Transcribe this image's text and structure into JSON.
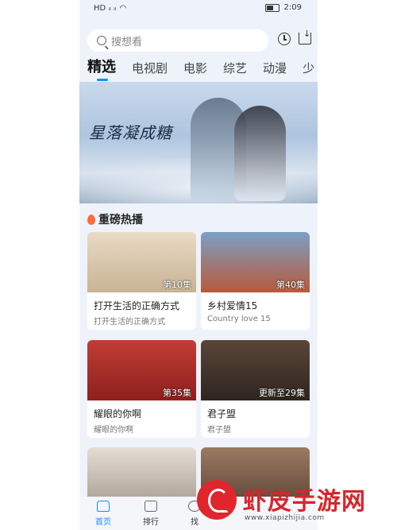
{
  "status_bar": {
    "time": "2:09",
    "signal": "HD ᵢₗ ᵢₗ"
  },
  "search": {
    "placeholder": "搜想看"
  },
  "tabs": [
    "精选",
    "电视剧",
    "电影",
    "综艺",
    "动漫",
    "少"
  ],
  "banner": {
    "title": "星落凝成糖"
  },
  "section": {
    "title": "重磅热播"
  },
  "cards": [
    {
      "title": "打开生活的正确方式",
      "subtitle": "打开生活的正确方式",
      "badge": "第10集",
      "thumb_color": "#d9c6ad"
    },
    {
      "title": "乡村爱情15",
      "subtitle": "Country love 15",
      "badge": "第40集",
      "thumb_color": "#6a8fb3"
    },
    {
      "title": "耀眼的你啊",
      "subtitle": "耀眼的你啊",
      "badge": "第35集",
      "thumb_color": "#b6322d"
    },
    {
      "title": "君子盟",
      "subtitle": "君子盟",
      "badge": "更新至29集",
      "thumb_color": "#4a3a30"
    },
    {
      "thumb_color": "#cfc5bd"
    },
    {
      "thumb_color": "#8a6a55"
    }
  ],
  "bottom_nav": [
    {
      "label": "首页",
      "active": true
    },
    {
      "label": "排行",
      "active": false
    },
    {
      "label": "找",
      "active": false
    }
  ],
  "watermark": {
    "text": "虾皮手游网",
    "url": "www.xiapizhijia.com"
  }
}
